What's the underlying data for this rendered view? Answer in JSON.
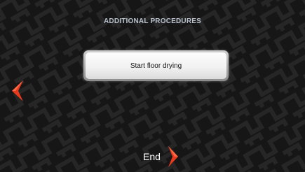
{
  "screen": {
    "title": "ADDITIONAL PROCEDURES"
  },
  "procedures": [
    {
      "label": "Start floor drying"
    }
  ],
  "navigation": {
    "back_icon": "chevron-left-icon",
    "end_label": "End",
    "end_icon": "chevron-right-icon"
  },
  "colors": {
    "background": "#161616",
    "pattern_line": "#2a2a2a",
    "title_text": "#b8c0cc",
    "arrow_accent": "#e63a1e",
    "button_face": "#f2f2f2"
  }
}
